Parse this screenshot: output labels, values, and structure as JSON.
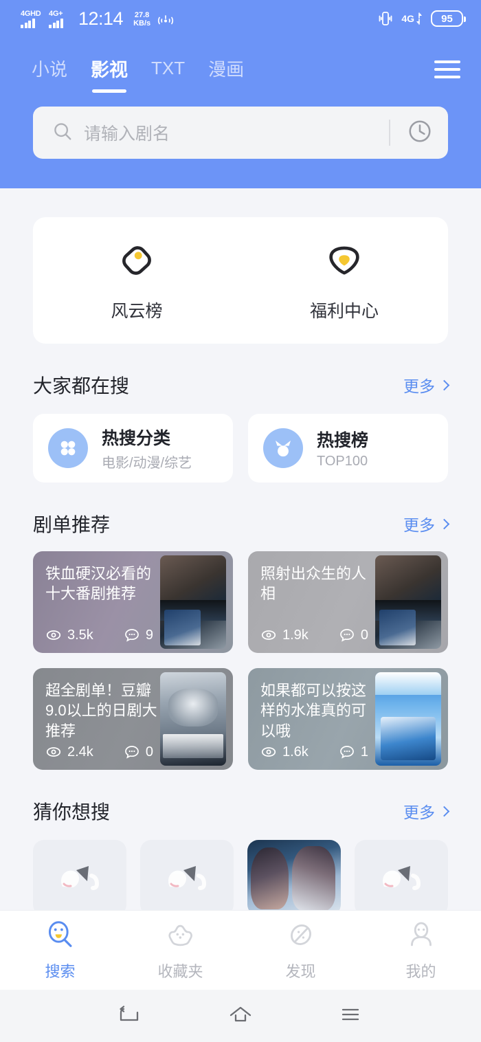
{
  "status_bar": {
    "signal1_label": "4GHD",
    "signal2_label": "4G+",
    "time": "12:14",
    "net_speed_value": "27.8",
    "net_speed_unit": "KB/s",
    "right_net_label": "4G",
    "battery": "95"
  },
  "header": {
    "tabs": [
      {
        "label": "小说",
        "active": false
      },
      {
        "label": "影视",
        "active": true
      },
      {
        "label": "TXT",
        "active": false
      },
      {
        "label": "漫画",
        "active": false
      }
    ],
    "menu_icon": "hamburger-menu-icon",
    "search": {
      "placeholder": "请输入剧名",
      "value": "",
      "search_icon": "search-icon",
      "history_icon": "clock-history-icon"
    }
  },
  "quick_entries": [
    {
      "label": "风云榜",
      "icon": "tag-icon"
    },
    {
      "label": "福利中心",
      "icon": "gift-shield-icon"
    }
  ],
  "hot_search": {
    "title": "大家都在搜",
    "more_label": "更多",
    "cards": [
      {
        "name": "热搜分类",
        "sub": "电影/动漫/综艺",
        "icon": "grid-flower-icon"
      },
      {
        "name": "热搜榜",
        "sub": "TOP100",
        "icon": "trophy-crown-icon"
      }
    ]
  },
  "drama_lists": {
    "title": "剧单推荐",
    "more_label": "更多",
    "items": [
      {
        "title": "铁血硬汉必看的十大番剧推荐",
        "views": "3.5k",
        "comments": "9",
        "poster": "poster-succession",
        "bg": "linear-gradient(115deg,#8a8296 0%,#9b91a6 45%,#8e96a0 100%)"
      },
      {
        "title": "照射出众生的人相",
        "views": "1.9k",
        "comments": "0",
        "poster": "poster-succession",
        "bg": "linear-gradient(115deg,#a9a9ad 0%,#b0b0b4 50%,#a6a6ab 100%)"
      },
      {
        "title": "超全剧单！豆瓣9.0以上的日剧大推荐",
        "views": "2.4k",
        "comments": "0",
        "poster": "poster-white",
        "bg": "linear-gradient(115deg,#86898e 0%,#8d9095 50%,#84878c 100%)"
      },
      {
        "title": "如果都可以按这样的水准真的可以哦",
        "views": "1.6k",
        "comments": "1",
        "poster": "poster-life",
        "bg": "linear-gradient(115deg,#8e9aa1 0%,#99a5ac 50%,#8b979e 100%)"
      }
    ],
    "views_icon": "eye-icon",
    "comments_icon": "comment-icon"
  },
  "guess": {
    "title": "猜你想搜",
    "more_label": "更多",
    "tiles": [
      {
        "state": "placeholder",
        "icon": "cat-placeholder-icon"
      },
      {
        "state": "placeholder",
        "icon": "cat-placeholder-icon"
      },
      {
        "state": "loaded",
        "icon": "anime-poster-image"
      },
      {
        "state": "placeholder",
        "icon": "cat-placeholder-icon"
      }
    ]
  },
  "bottom_nav": [
    {
      "label": "搜索",
      "icon": "search-face-icon",
      "active": true
    },
    {
      "label": "收藏夹",
      "icon": "paw-favorites-icon",
      "active": false
    },
    {
      "label": "发现",
      "icon": "discover-planet-icon",
      "active": false
    },
    {
      "label": "我的",
      "icon": "person-profile-icon",
      "active": false
    }
  ],
  "android_nav": [
    {
      "icon": "back-icon"
    },
    {
      "icon": "home-icon"
    },
    {
      "icon": "recents-icon"
    }
  ],
  "colors": {
    "header_blue": "#6c94f7",
    "accent_blue": "#5a8df0",
    "page_bg": "#f4f5f9",
    "accent_yellow": "#f5c731",
    "icon_light_blue": "#9cc0f7"
  }
}
